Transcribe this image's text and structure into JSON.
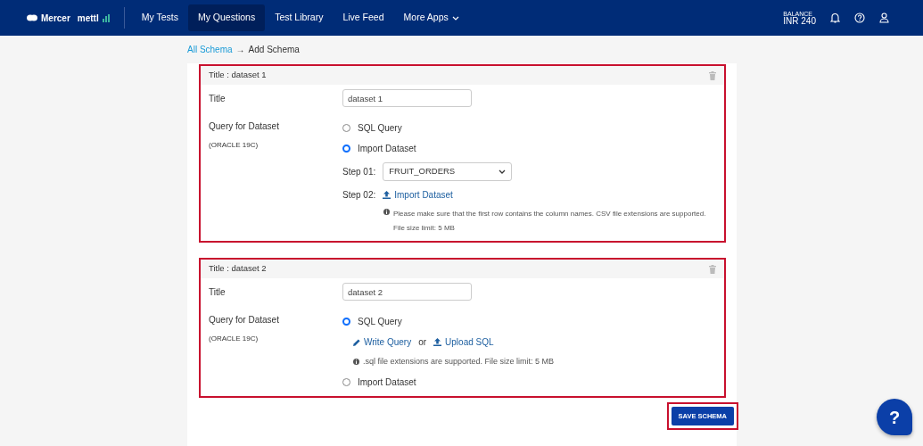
{
  "navbar": {
    "logo": {
      "brand": "Mercer",
      "product": "mettl"
    },
    "tabs": [
      {
        "label": "My Tests",
        "selected": false,
        "dropdown": false
      },
      {
        "label": "My Questions",
        "selected": true,
        "dropdown": false
      },
      {
        "label": "Test Library",
        "selected": false,
        "dropdown": false
      },
      {
        "label": "Live Feed",
        "selected": false,
        "dropdown": false
      },
      {
        "label": "More Apps",
        "selected": false,
        "dropdown": true
      }
    ],
    "balance": {
      "label": "BALANCE",
      "value": "INR 240"
    }
  },
  "breadcrumb": {
    "link": "All Schema",
    "separator": "→",
    "current": "Add Schema"
  },
  "datasets": [
    {
      "header": "Title : dataset 1",
      "highlighted": true,
      "title_label": "Title",
      "title_value": "dataset 1",
      "query_label": "Query for Dataset",
      "query_note": "(ORACLE 19C)",
      "options": [
        {
          "label": "SQL Query",
          "selected": false
        },
        {
          "label": "Import Dataset",
          "selected": true,
          "details": {
            "kind": "import",
            "step1_label": "Step 01:",
            "step1_value": "FRUIT_ORDERS",
            "step2_label": "Step 02:",
            "step2_link": "Import Dataset",
            "hint": "Please make sure that the first row contains the column names. CSV file extensions are supported.",
            "hint_2": "File size limit: 5 MB"
          }
        }
      ]
    },
    {
      "header": "Title : dataset 2",
      "highlighted": true,
      "title_label": "Title",
      "title_value": "dataset 2",
      "query_label": "Query for Dataset",
      "query_note": "(ORACLE 19C)",
      "options": [
        {
          "label": "SQL Query",
          "selected": true,
          "details": {
            "kind": "sql",
            "write_link": "Write Query",
            "or": "or",
            "upload_link": "Upload SQL",
            "hint": ".sql file extensions are supported. File size limit: 5 MB"
          }
        },
        {
          "label": "Import Dataset",
          "selected": false
        }
      ]
    }
  ],
  "save_button": {
    "label": "SAVE SCHEMA",
    "highlighted": true
  },
  "help_button": {
    "label": "?"
  }
}
